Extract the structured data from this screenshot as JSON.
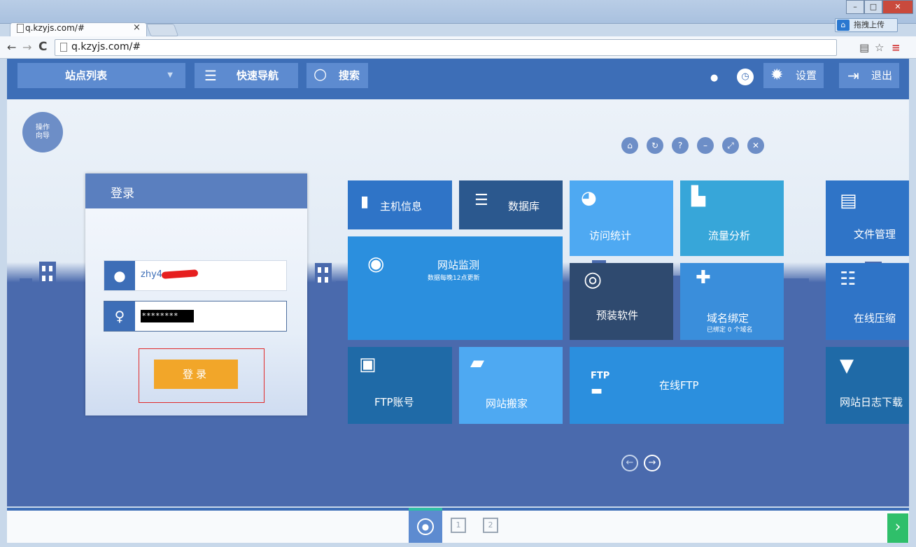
{
  "browser": {
    "tab_title": "q.kzyjs.com/#",
    "url": "q.kzyjs.com/#",
    "upload_label": "拖拽上传"
  },
  "header": {
    "site_list": "站点列表",
    "quick_nav": "快速导航",
    "search": "搜索",
    "settings": "设置",
    "logout": "退出"
  },
  "guide": {
    "line1": "操作",
    "line2": "向导"
  },
  "login": {
    "title": "登录",
    "username": "zhy4",
    "password_mask": "********",
    "button": "登录"
  },
  "tiles": {
    "host": "主机信息",
    "database": "数据库",
    "visit_stats": "访问统计",
    "traffic": "流量分析",
    "files": "文件管理",
    "monitor": "网站监测",
    "monitor_sub": "数据每晚12点更新",
    "software": "预装软件",
    "domain": "域名绑定",
    "domain_sub": "已绑定 0 个域名",
    "zip": "在线压缩",
    "ftp_account": "FTP账号",
    "site_move": "网站搬家",
    "ftp_icon_text": "FTP",
    "online_ftp": "在线FTP",
    "log_download": "网站日志下载"
  },
  "bottom": {
    "page1": "1",
    "page2": "2"
  },
  "colors": {
    "header_bg": "#3d6eb7",
    "login_button": "#f2a629",
    "next_button": "#2fbf6a"
  }
}
